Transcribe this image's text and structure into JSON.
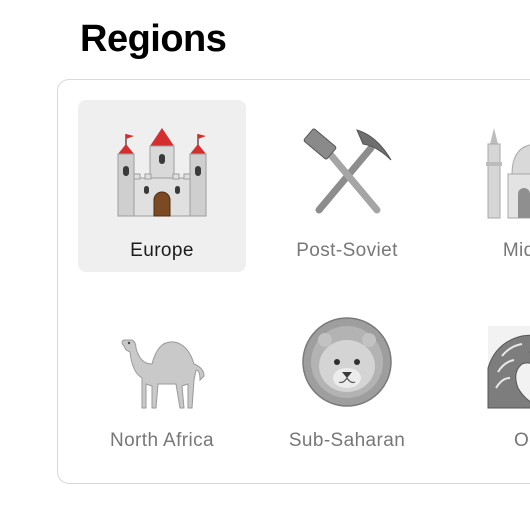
{
  "header": {
    "title": "Regions"
  },
  "regions": [
    {
      "label": "Europe",
      "icon": "castle-icon",
      "selected": true
    },
    {
      "label": "Post-Soviet",
      "icon": "hammer-and-pick-icon",
      "selected": false
    },
    {
      "label": "Middle",
      "icon": "mosque-icon",
      "selected": false
    },
    {
      "label": "North Africa",
      "icon": "camel-icon",
      "selected": false
    },
    {
      "label": "Sub-Saharan",
      "icon": "lion-icon",
      "selected": false
    },
    {
      "label": "Oce",
      "icon": "wave-icon",
      "selected": false
    }
  ],
  "colors": {
    "selected_tile_bg": "#efefef",
    "panel_border": "#d9d9d9",
    "label_inactive": "#777777",
    "label_active": "#1c1c1c",
    "castle_roof_red": "#d32f2f"
  }
}
